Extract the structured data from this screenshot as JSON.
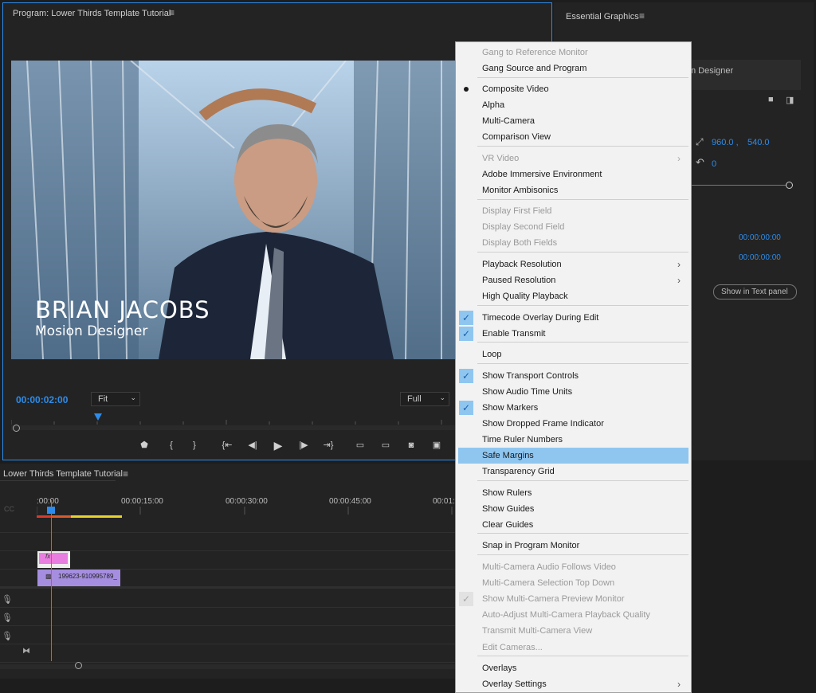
{
  "program": {
    "title": "Program: Lower Thirds Template Tutorial",
    "timecode": "00:00:02:00",
    "fit": "Fit",
    "full": "Full",
    "lower_third_name": "BRIAN JACOBS",
    "lower_third_role": "Mosion Designer"
  },
  "essential_graphics": {
    "title": "Essential Graphics",
    "layer_partial": "n Designer",
    "pos_x": "960.0 ,",
    "pos_y": "540.0",
    "rotation": "0",
    "time_in": "00:00:00:00",
    "time_out": "00:00:00:00",
    "show_in_text_panel": "Show in Text panel"
  },
  "timeline": {
    "title": "Lower Thirds Template Tutorial",
    "ruler": [
      ":00:00",
      "00:00:15:00",
      "00:00:30:00",
      "00:00:45:00",
      "00:01:0"
    ],
    "fx_label": "fx",
    "clip_name": "199623-910995789_"
  },
  "menu": {
    "items": [
      {
        "label": "Gang to Reference Monitor",
        "disabled": true
      },
      {
        "label": "Gang Source and Program"
      },
      {
        "label": "Composite Video",
        "mark": "dot"
      },
      {
        "label": "Alpha"
      },
      {
        "label": "Multi-Camera"
      },
      {
        "label": "Comparison View"
      },
      {
        "label": "VR Video",
        "disabled": true,
        "submenu": true
      },
      {
        "label": "Adobe Immersive Environment"
      },
      {
        "label": "Monitor Ambisonics"
      },
      {
        "label": "Display First Field",
        "disabled": true
      },
      {
        "label": "Display Second Field",
        "disabled": true
      },
      {
        "label": "Display Both Fields",
        "disabled": true
      },
      {
        "label": "Playback Resolution",
        "submenu": true
      },
      {
        "label": "Paused Resolution",
        "submenu": true
      },
      {
        "label": "High Quality Playback"
      },
      {
        "label": "Timecode Overlay During Edit",
        "mark": "check"
      },
      {
        "label": "Enable Transmit",
        "mark": "check"
      },
      {
        "label": "Loop"
      },
      {
        "label": "Show Transport Controls",
        "mark": "check"
      },
      {
        "label": "Show Audio Time Units"
      },
      {
        "label": "Show Markers",
        "mark": "check"
      },
      {
        "label": "Show Dropped Frame Indicator"
      },
      {
        "label": "Time Ruler Numbers"
      },
      {
        "label": "Safe Margins",
        "highlighted": true
      },
      {
        "label": "Transparency Grid"
      },
      {
        "label": "Show Rulers"
      },
      {
        "label": "Show Guides"
      },
      {
        "label": "Clear Guides"
      },
      {
        "label": "Snap in Program Monitor"
      },
      {
        "label": "Multi-Camera Audio Follows Video",
        "disabled": true
      },
      {
        "label": "Multi-Camera Selection Top Down",
        "disabled": true
      },
      {
        "label": "Show Multi-Camera Preview Monitor",
        "disabled": true,
        "mark": "check"
      },
      {
        "label": "Auto-Adjust Multi-Camera Playback Quality",
        "disabled": true
      },
      {
        "label": "Transmit Multi-Camera View",
        "disabled": true
      },
      {
        "label": "Edit Cameras...",
        "disabled": true
      },
      {
        "label": "Overlays"
      },
      {
        "label": "Overlay Settings",
        "submenu": true
      }
    ]
  },
  "colors": {
    "accent": "#2d8ceb",
    "menu_highlight": "#8fc6f0",
    "clip_purple": "#a58ee0",
    "clip_pink": "#e87fe0"
  }
}
